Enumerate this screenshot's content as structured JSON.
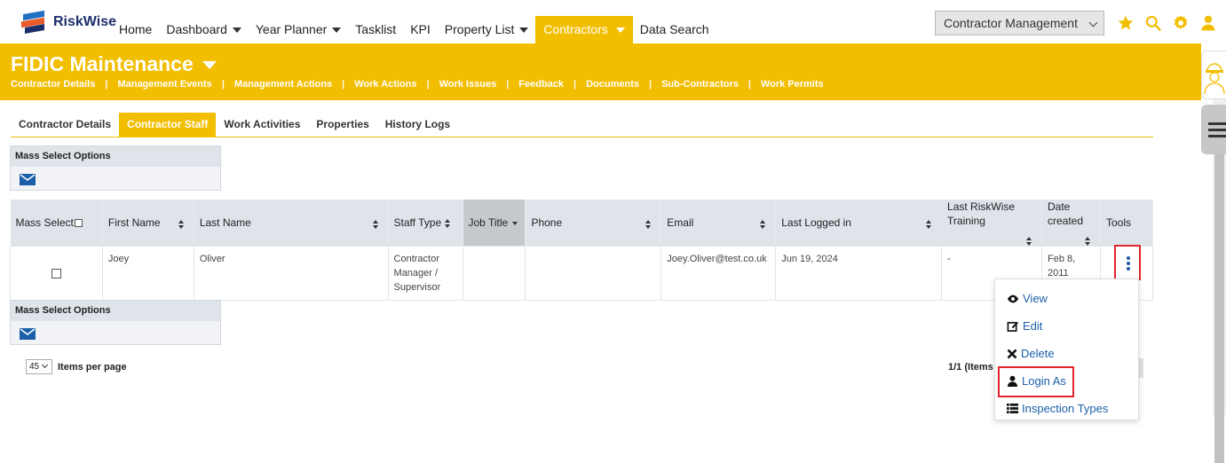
{
  "app": {
    "name": "RiskWise"
  },
  "nav": {
    "items": [
      {
        "label": "Home",
        "dropdown": false
      },
      {
        "label": "Dashboard",
        "dropdown": true
      },
      {
        "label": "Year Planner",
        "dropdown": true
      },
      {
        "label": "Tasklist",
        "dropdown": false
      },
      {
        "label": "KPI",
        "dropdown": false
      },
      {
        "label": "Property List",
        "dropdown": true
      },
      {
        "label": "Contractors",
        "dropdown": true,
        "active": true
      },
      {
        "label": "Data Search",
        "dropdown": false
      }
    ],
    "module_select": "Contractor Management",
    "icons": [
      "star-icon",
      "search-icon",
      "gear-icon",
      "user-icon"
    ]
  },
  "header": {
    "title": "FIDIC Maintenance",
    "links": [
      "Contractor Details",
      "Management Events",
      "Management Actions",
      "Work Actions",
      "Work Issues",
      "Feedback",
      "Documents",
      "Sub-Contractors",
      "Work Permits"
    ]
  },
  "tabs": [
    {
      "label": "Contractor Details"
    },
    {
      "label": "Contractor Staff",
      "active": true
    },
    {
      "label": "Work Activities"
    },
    {
      "label": "Properties"
    },
    {
      "label": "History Logs"
    }
  ],
  "mass_select": {
    "label": "Mass Select Options"
  },
  "table": {
    "columns": [
      "Mass Select",
      "First Name",
      "Last Name",
      "Staff Type",
      "Job Title",
      "Phone",
      "Email",
      "Last Logged in",
      "Last RiskWise Training",
      "Date created",
      "Tools"
    ],
    "rows": [
      {
        "first_name": "Joey",
        "last_name": "Oliver",
        "staff_type": "Contractor Manager / Supervisor",
        "job_title": "",
        "phone": "",
        "email": "Joey.Oliver@test.co.uk",
        "last_logged_in": "Jun 19, 2024",
        "last_training": "-",
        "date_created": "Feb 8, 2011"
      }
    ]
  },
  "tools_menu": {
    "items": [
      "View",
      "Edit",
      "Delete",
      "Login As",
      "Inspection Types"
    ]
  },
  "pagination": {
    "per_page": "45",
    "per_page_label": "Items per page",
    "info": "1/1 (Items"
  },
  "colors": {
    "accent": "#f2be00",
    "brand_blue": "#1d2f6b",
    "link": "#1a5fa8",
    "highlight": "#e0252c"
  }
}
